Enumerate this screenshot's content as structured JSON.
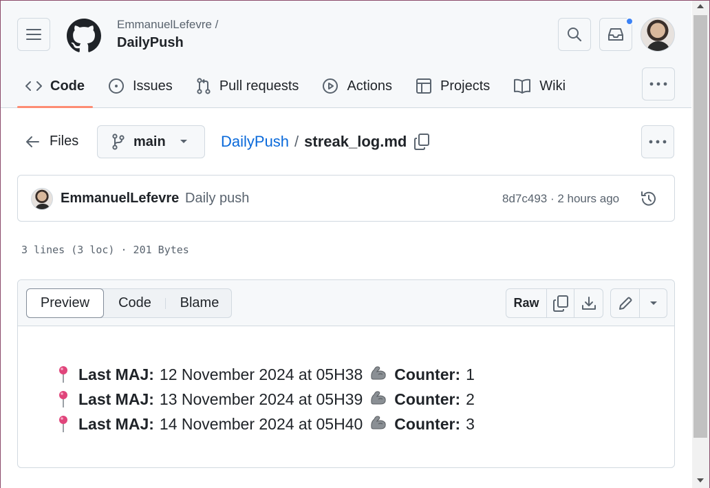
{
  "header": {
    "owner": "EmmanuelLefevre /",
    "repo": "DailyPush"
  },
  "nav": {
    "tabs": [
      {
        "label": "Code",
        "icon": "code-icon",
        "selected": true
      },
      {
        "label": "Issues",
        "icon": "issue-opened-icon"
      },
      {
        "label": "Pull requests",
        "icon": "git-pull-request-icon"
      },
      {
        "label": "Actions",
        "icon": "play-icon"
      },
      {
        "label": "Projects",
        "icon": "table-icon"
      },
      {
        "label": "Wiki",
        "icon": "book-icon"
      }
    ]
  },
  "file_header": {
    "files_label": "Files",
    "branch": "main",
    "breadcrumb_repo": "DailyPush",
    "breadcrumb_sep": "/",
    "file_name": "streak_log.md"
  },
  "commit": {
    "author": "EmmanuelLefevre",
    "message": "Daily push",
    "meta": "8d7c493 · 2 hours ago"
  },
  "file_stats": "3 lines (3 loc) · 201 Bytes",
  "viewer": {
    "tabs": {
      "preview": "Preview",
      "code": "Code",
      "blame": "Blame"
    },
    "raw_label": "Raw"
  },
  "content": {
    "lines": [
      {
        "label": "Last MAJ:",
        "date": "12 November 2024 at 05H38",
        "counter_label": "Counter:",
        "counter": "1"
      },
      {
        "label": "Last MAJ:",
        "date": "13 November 2024 at 05H39",
        "counter_label": "Counter:",
        "counter": "2"
      },
      {
        "label": "Last MAJ:",
        "date": "14 November 2024 at 05H40",
        "counter_label": "Counter:",
        "counter": "3"
      }
    ]
  },
  "colors": {
    "accent_link": "#0969da",
    "nav_underline": "#fd8c73",
    "notification_dot": "#3b82f6",
    "pin": "#e0457b"
  }
}
